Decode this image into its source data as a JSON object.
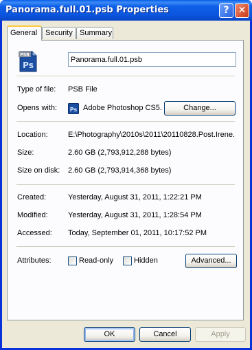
{
  "window": {
    "title": "Panorama.full.01.psb Properties",
    "help_glyph": "?",
    "close_glyph": "✕"
  },
  "tabs": [
    {
      "label": "General",
      "active": true
    },
    {
      "label": "Security",
      "active": false
    },
    {
      "label": "Summary",
      "active": false
    }
  ],
  "general": {
    "file_icon": {
      "name": "photoshop-psb-file-icon",
      "tag": "PSB",
      "glyph": "Ps"
    },
    "filename": "Panorama.full.01.psb",
    "type_label": "Type of file:",
    "type_value": "PSB File",
    "opens_label": "Opens with:",
    "opens_app_icon": "photoshop-icon",
    "opens_glyph": "Ps",
    "opens_value": "Adobe Photoshop CS5.",
    "change_button": "Change...",
    "location_label": "Location:",
    "location_value": "E:\\Photography\\2010s\\2011\\20110828.Post.Irene.",
    "size_label": "Size:",
    "size_value": "2.60 GB (2,793,912,288 bytes)",
    "size_disk_label": "Size on disk:",
    "size_disk_value": "2.60 GB (2,793,914,368 bytes)",
    "created_label": "Created:",
    "created_value": "Yesterday, August 31, 2011, 1:22:21 PM",
    "modified_label": "Modified:",
    "modified_value": "Yesterday, August 31, 2011, 1:28:54 PM",
    "accessed_label": "Accessed:",
    "accessed_value": "Today, September 01, 2011, 10:17:52 PM",
    "attributes_label": "Attributes:",
    "readonly_label": "Read-only",
    "readonly_checked": false,
    "hidden_label": "Hidden",
    "hidden_checked": false,
    "advanced_button": "Advanced..."
  },
  "footer": {
    "ok": "OK",
    "cancel": "Cancel",
    "apply": "Apply"
  },
  "colors": {
    "titlebar": "#0b56e0",
    "dialog_bg": "#ece9d8",
    "photoshop_blue": "#1c4fa1"
  }
}
